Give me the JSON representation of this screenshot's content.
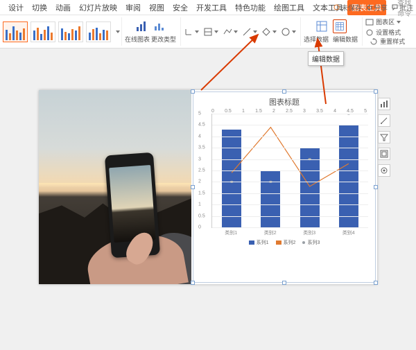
{
  "tabs": {
    "items": [
      "设计",
      "切换",
      "动画",
      "幻灯片放映",
      "审阅",
      "视图",
      "安全",
      "开发工具",
      "特色功能",
      "绘图工具",
      "文本工具",
      "图表工具"
    ],
    "active_index": 11
  },
  "search": {
    "placeholder": "查找命令"
  },
  "topright": {
    "unsaved": "未保存",
    "share": "分享",
    "annotate": "批注"
  },
  "ribbon": {
    "online_chart": "在线图表",
    "change_type": "更改类型",
    "select_data": "选择数据",
    "edit_data": "编辑数据",
    "chart_area": "图表区",
    "format": "设置格式",
    "reset_style": "重置样式"
  },
  "tooltip": {
    "edit_data": "编辑数据"
  },
  "chart_data": {
    "type": "bar+line",
    "title": "图表标题",
    "categories": [
      "类别1",
      "类别2",
      "类别3",
      "类别4"
    ],
    "series": [
      {
        "name": "系列1",
        "type": "bar",
        "values": [
          4.3,
          2.5,
          3.5,
          4.5
        ],
        "color": "#3a60b1"
      },
      {
        "name": "系列2",
        "type": "line",
        "values": [
          2.4,
          4.4,
          1.8,
          2.8
        ],
        "color": "#e07a30",
        "axis": "secondary"
      },
      {
        "name": "系列3",
        "type": "scatter",
        "values": [
          2.0,
          2.0,
          3.0,
          5.0
        ],
        "color": "#9aa0a6"
      }
    ],
    "ylabel": "",
    "ylim": [
      0,
      5
    ],
    "yticks": [
      0,
      0.5,
      1,
      1.5,
      2,
      2.5,
      3,
      3.5,
      4,
      4.5,
      5
    ],
    "secondary_ticks": [
      0,
      0.5,
      1,
      1.5,
      2,
      2.5,
      3,
      3.5,
      4,
      4.5,
      5
    ],
    "legend": [
      "系列1",
      "系列2",
      "系列3"
    ]
  }
}
